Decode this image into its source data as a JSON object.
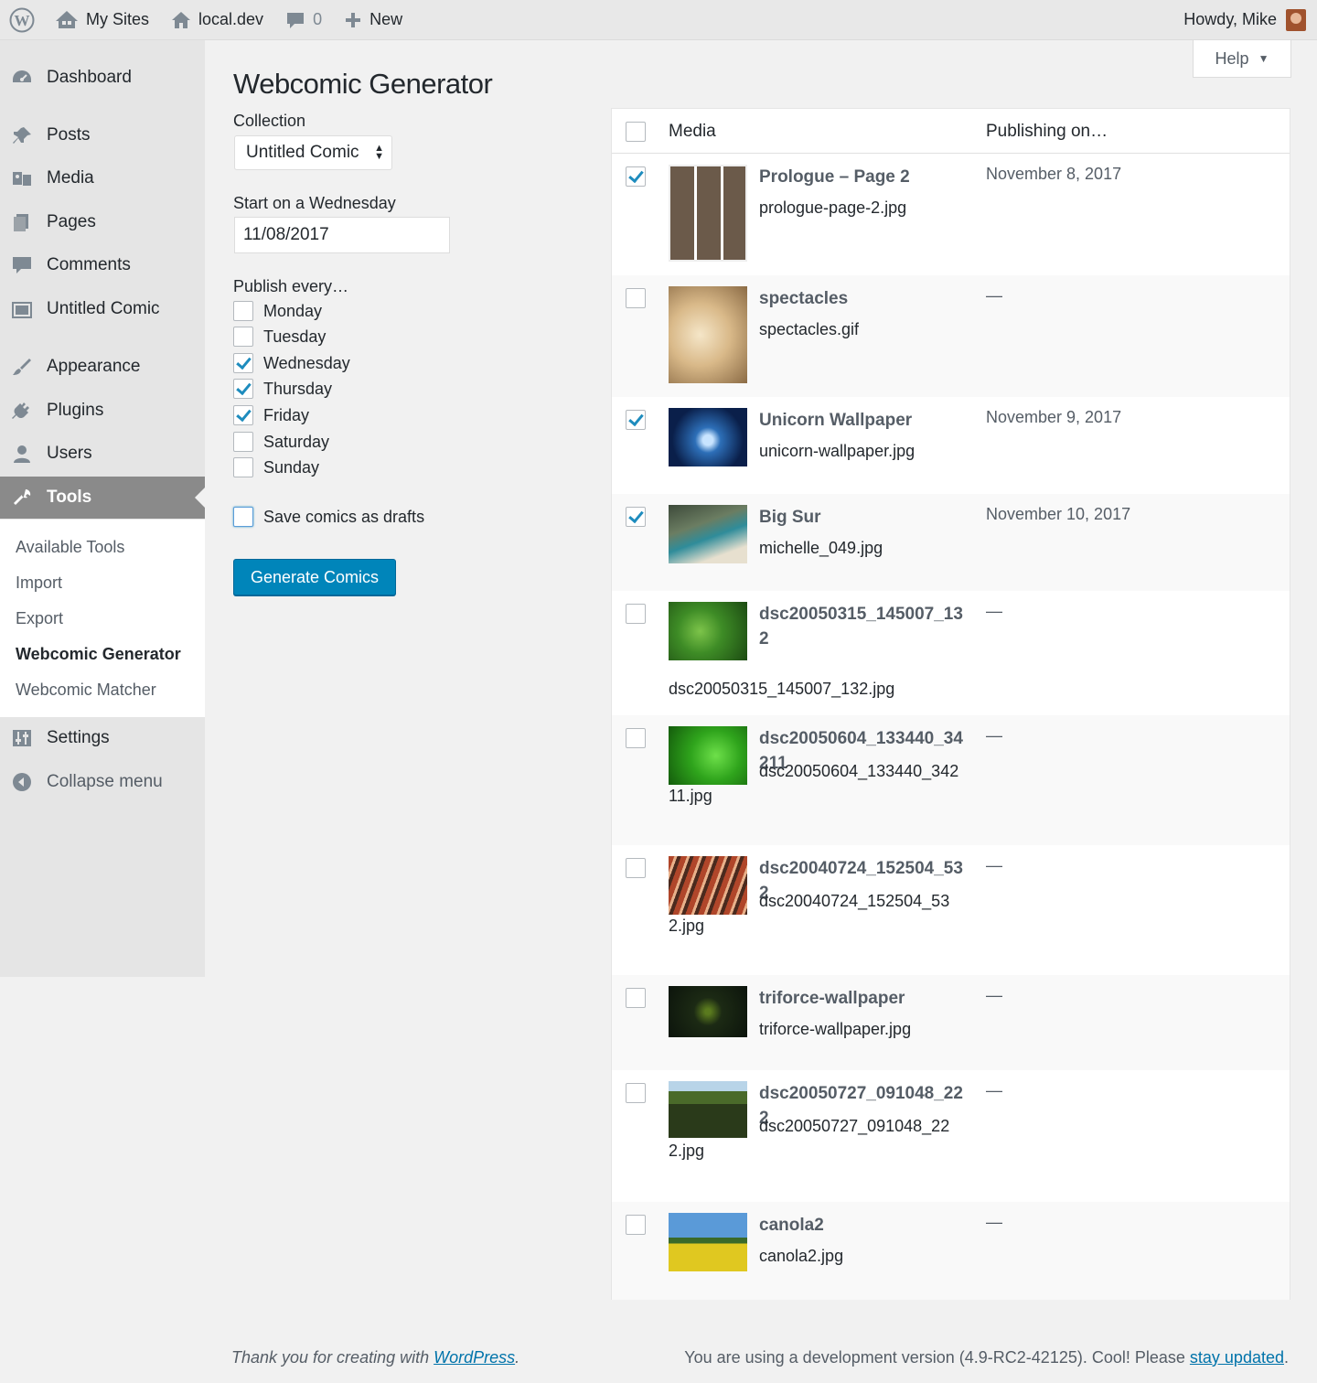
{
  "adminbar": {
    "my_sites": "My Sites",
    "site": "local.dev",
    "comments_count": "0",
    "new": "New",
    "howdy": "Howdy, Mike"
  },
  "sidebar": {
    "items": [
      {
        "label": "Dashboard",
        "icon": "dashboard-icon"
      },
      {
        "label": "Posts",
        "icon": "pin-icon"
      },
      {
        "label": "Media",
        "icon": "media-icon"
      },
      {
        "label": "Pages",
        "icon": "pages-icon"
      },
      {
        "label": "Comments",
        "icon": "comment-icon"
      },
      {
        "label": "Untitled Comic",
        "icon": "gallery-icon"
      },
      {
        "label": "Appearance",
        "icon": "brush-icon"
      },
      {
        "label": "Plugins",
        "icon": "plug-icon"
      },
      {
        "label": "Users",
        "icon": "user-icon"
      },
      {
        "label": "Tools",
        "icon": "wrench-icon"
      },
      {
        "label": "Settings",
        "icon": "sliders-icon"
      },
      {
        "label": "Collapse menu",
        "icon": "collapse-arrow-icon"
      }
    ],
    "submenu": [
      "Available Tools",
      "Import",
      "Export",
      "Webcomic Generator",
      "Webcomic Matcher"
    ]
  },
  "help": "Help",
  "form": {
    "title": "Webcomic Generator",
    "collection_label": "Collection",
    "collection_value": "Untitled Comic",
    "start_label": "Start on a Wednesday",
    "start_value": "11/08/2017",
    "publish_label": "Publish every…",
    "days": [
      {
        "name": "Monday",
        "checked": false
      },
      {
        "name": "Tuesday",
        "checked": false
      },
      {
        "name": "Wednesday",
        "checked": true
      },
      {
        "name": "Thursday",
        "checked": true
      },
      {
        "name": "Friday",
        "checked": true
      },
      {
        "name": "Saturday",
        "checked": false
      },
      {
        "name": "Sunday",
        "checked": false
      }
    ],
    "drafts_label": "Save comics as drafts",
    "drafts_checked": false,
    "button": "Generate Comics"
  },
  "table": {
    "col_media": "Media",
    "col_publishing": "Publishing on…",
    "rows": [
      {
        "title": "Prologue – Page 2",
        "file": "prologue-page-2.jpg",
        "date": "November 8, 2017",
        "checked": true
      },
      {
        "title": "spectacles",
        "file": "spectacles.gif",
        "date": "—",
        "checked": false
      },
      {
        "title": "Unicorn Wallpaper",
        "file": "unicorn-wallpaper.jpg",
        "date": "November 9, 2017",
        "checked": true
      },
      {
        "title": "Big Sur",
        "file": "michelle_049.jpg",
        "date": "November 10, 2017",
        "checked": true
      },
      {
        "title": "dsc20050315_145007_132",
        "file": "dsc20050315_145007_132.jpg",
        "date": "—",
        "checked": false
      },
      {
        "title": "dsc20050604_133440_34211",
        "file": "dsc20050604_133440_34211.jpg",
        "date": "—",
        "checked": false
      },
      {
        "title": "dsc20040724_152504_532",
        "file": "dsc20040724_152504_532.jpg",
        "date": "—",
        "checked": false
      },
      {
        "title": "triforce-wallpaper",
        "file": "triforce-wallpaper.jpg",
        "date": "—",
        "checked": false
      },
      {
        "title": "dsc20050727_091048_222",
        "file": "dsc20050727_091048_222.jpg",
        "date": "—",
        "checked": false
      },
      {
        "title": "canola2",
        "file": "canola2.jpg",
        "date": "—",
        "checked": false
      }
    ]
  },
  "footer": {
    "left_prefix": "Thank you for creating with ",
    "left_link": "WordPress",
    "left_suffix": ".",
    "right_prefix": "You are using a development version (4.9-RC2-42125). Cool! Please ",
    "right_link": "stay updated",
    "right_suffix": "."
  }
}
